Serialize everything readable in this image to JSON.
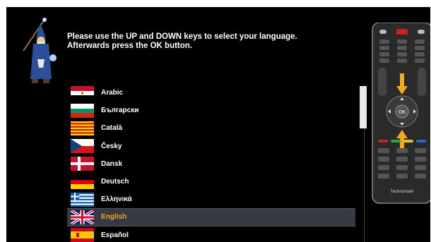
{
  "instructions": {
    "line1": "Please use the UP and DOWN keys to select your language.",
    "line2": "Afterwards press the OK button."
  },
  "languages": [
    {
      "label": "Arabic",
      "flag": "eg"
    },
    {
      "label": "Български",
      "flag": "bg"
    },
    {
      "label": "Català",
      "flag": "ca"
    },
    {
      "label": "Česky",
      "flag": "cz"
    },
    {
      "label": "Dansk",
      "flag": "dk"
    },
    {
      "label": "Deutsch",
      "flag": "de"
    },
    {
      "label": "Ελληνικά",
      "flag": "gr"
    },
    {
      "label": "English",
      "flag": "gb",
      "selected": true
    },
    {
      "label": "Español",
      "flag": "es"
    }
  ],
  "remote": {
    "brand": "Technomate",
    "ok_label": "OK"
  },
  "colors": {
    "selected_text": "#f0a817",
    "selected_bg": "#373a44",
    "arrow": "#f2a81d"
  }
}
